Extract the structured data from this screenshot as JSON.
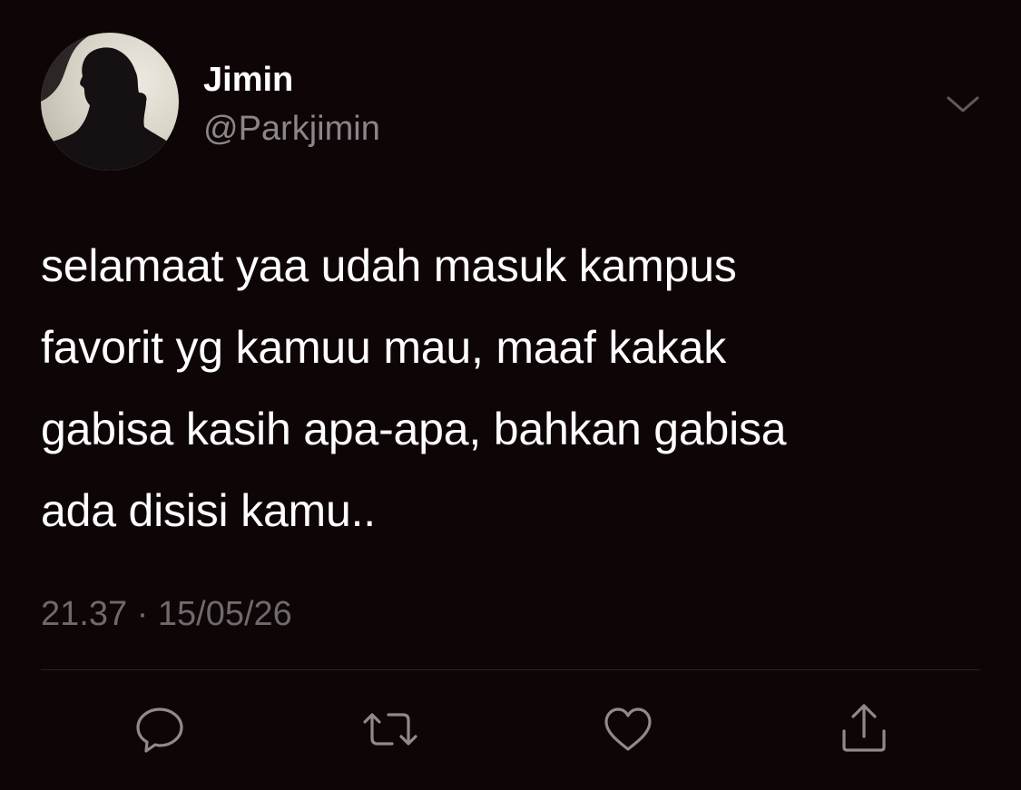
{
  "tweet": {
    "author": {
      "display_name": "Jimin",
      "handle": "@Parkjimin",
      "avatar": "silhouette-avatar"
    },
    "text_lines": [
      "selamaat yaa udah masuk kampus",
      "favorit yg kamuu mau, maaf kakak",
      "gabisa kasih apa-apa, bahkan gabisa",
      "ada disisi kamu.."
    ],
    "time": "21.37",
    "separator": "·",
    "date": "15/05/26"
  },
  "icons": {
    "menu": "chevron-down-icon",
    "reply": "reply-icon",
    "retweet": "retweet-icon",
    "like": "heart-icon",
    "share": "share-icon"
  },
  "colors": {
    "background": "#0e0506",
    "primary_text": "#ffffff",
    "secondary_text": "#8b8688",
    "icon": "#8f8a8c",
    "divider": "#2a2224"
  }
}
